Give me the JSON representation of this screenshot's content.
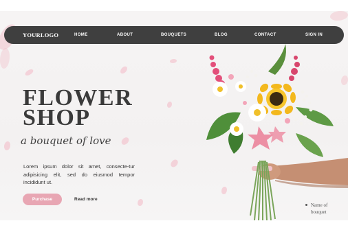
{
  "logo": "YOURLOGO",
  "nav": {
    "items": [
      "HOME",
      "ABOUT",
      "BOUQUETS",
      "BLOG",
      "CONTACT",
      "SIGN IN"
    ]
  },
  "hero": {
    "title_line1": "FLOWER",
    "title_line2": "SHOP",
    "tagline": "a bouquet of love",
    "body": "Lorem ipsum dolor sit amet, consecte-tur adipisicing elit, sed do eiusmod tempor incididunt ut.",
    "purchase_label": "Purchase",
    "read_more_label": "Read more"
  },
  "caption": {
    "line1": "Name of",
    "line2": "bouquet"
  },
  "colors": {
    "nav_bg": "#3f3f3f",
    "accent_pink": "#e8a6b3",
    "title": "#3a3a3a"
  },
  "icons": [
    "bouquet-image",
    "bullet-dot-icon"
  ]
}
